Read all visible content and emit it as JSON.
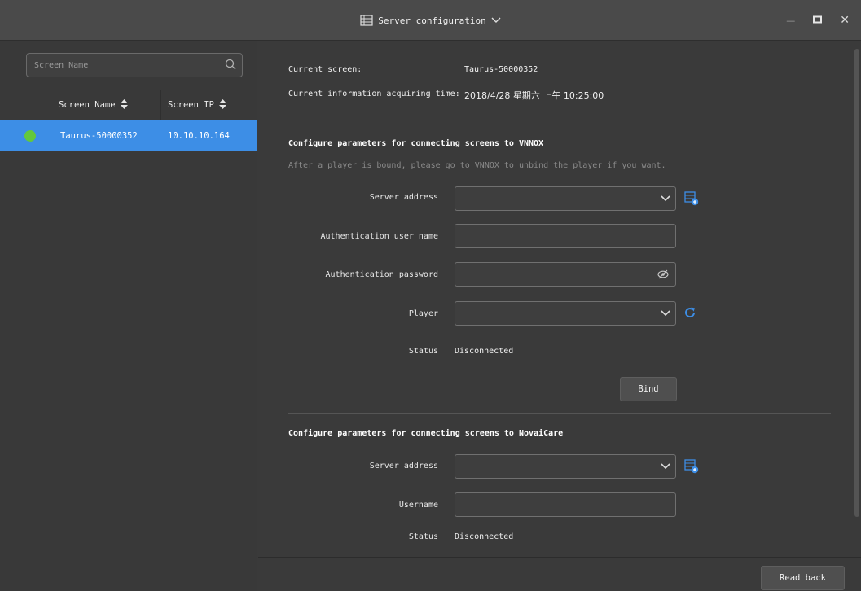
{
  "window": {
    "title": "Server configuration",
    "controls": {
      "minimize": "—",
      "maximize": "◻",
      "close": "✕"
    }
  },
  "left_panel": {
    "search": {
      "placeholder": "Screen Name"
    },
    "columns": [
      "Screen Name",
      "Screen IP"
    ],
    "rows": [
      {
        "status": "online",
        "status_color": "#63c83c",
        "name": "Taurus-50000352",
        "ip": "10.10.10.164"
      }
    ]
  },
  "current_screen": {
    "label": "Current screen:",
    "value": "Taurus-50000352"
  },
  "acquiring_time": {
    "label": "Current information acquiring time:",
    "value": "2018/4/28 星期六 上午 10:25:00"
  },
  "vnnox": {
    "heading": "Configure parameters for connecting screens to VNNOX",
    "hint": "After a player is bound, please go to VNNOX to unbind the player if you want.",
    "server_address_label": "Server address",
    "auth_user_label": "Authentication user name",
    "auth_password_label": "Authentication password",
    "player_label": "Player",
    "status_label": "Status",
    "status_value": "Disconnected",
    "bind_button": "Bind"
  },
  "novaicare": {
    "heading": "Configure parameters for connecting screens to NovaiCare",
    "server_address_label": "Server address",
    "username_label": "Username",
    "status_label": "Status",
    "status_value": "Disconnected"
  },
  "footer": {
    "read_back_button": "Read back"
  },
  "colors": {
    "accent": "#3d8ee6",
    "online": "#63c83c",
    "background": "#3a3a3a",
    "titlebar": "#4a4a4a"
  }
}
